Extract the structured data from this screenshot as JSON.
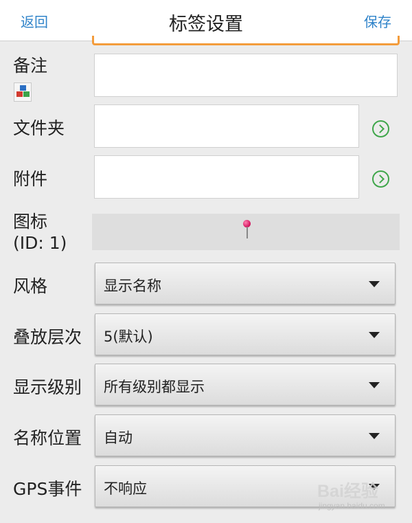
{
  "topbar": {
    "back_label": "返回",
    "title": "标签设置",
    "save_label": "保存"
  },
  "fields": {
    "note_label": "备注",
    "folder_label": "文件夹",
    "attachment_label": "附件",
    "icon_label_line1": "图标",
    "icon_label_line2": "(ID: 1)"
  },
  "dropdowns": {
    "style": {
      "label": "风格",
      "value": "显示名称"
    },
    "stack_level": {
      "label": "叠放层次",
      "value": "5(默认)"
    },
    "display_level": {
      "label": "显示级别",
      "value": "所有级别都显示"
    },
    "name_position": {
      "label": "名称位置",
      "value": "自动"
    },
    "gps_event": {
      "label": "GPS事件",
      "value": "不响应"
    }
  },
  "watermark": {
    "brand": "Bai经验",
    "site": "jingyan.baidu.com"
  },
  "icons": {
    "note": "note-blocks-icon",
    "folder_go": "chevron-right-circle-icon",
    "attachment_go": "chevron-right-circle-icon",
    "map_pin": "map-pin-icon",
    "caret": "caret-down-icon"
  },
  "colors": {
    "accent": "#2f83c9",
    "focus_border": "#f39c3c",
    "go_icon": "#3fa64a",
    "pin": "#d0105a",
    "background": "#ececec"
  }
}
